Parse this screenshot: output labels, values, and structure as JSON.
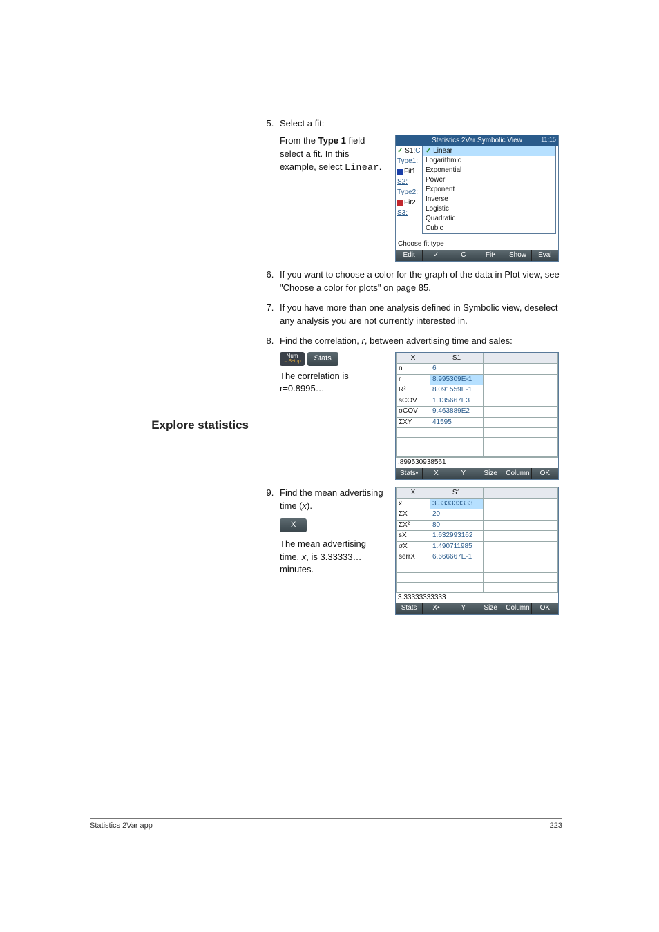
{
  "steps": {
    "s5_lead": "Select a fit:",
    "s5_body_1": "From the ",
    "s5_body_bold": "Type 1",
    "s5_body_2": " field select a fit. In this example, select ",
    "s5_body_mono": "Linear",
    "s5_body_3": ".",
    "s6": "If you want to choose a color for the graph of the data in Plot view, see \"Choose a color for plots\" on page 85.",
    "s7": "If you have more than one analysis defined in Symbolic view, deselect any analysis you are not currently interested in.",
    "s8_lead_1": "Find the correlation, ",
    "s8_lead_r": "r",
    "s8_lead_2": ", between advertising time and sales:",
    "s8_res_1": "The correlation is r=0.8995…",
    "s9_lead_1": "Find the mean advertising time (",
    "s9_lead_2": ").",
    "s9_res_1": "The mean advertising time, ",
    "s9_res_2": ", is 3.33333… minutes."
  },
  "side_heading": "Explore statistics",
  "keys": {
    "num_top": "Num",
    "num_bottom": "Setup",
    "stats": "Stats",
    "x": "X"
  },
  "calc1": {
    "title": "Statistics 2Var Symbolic View",
    "time": "11:15",
    "left_labels": [
      "✓ S1:",
      "Type1:",
      "Fit1",
      "S2:",
      "Type2:",
      "Fit2",
      "S3:"
    ],
    "dropdown": [
      "Linear",
      "Logarithmic",
      "Exponential",
      "Power",
      "Exponent",
      "Inverse",
      "Logistic",
      "Quadratic",
      "Cubic"
    ],
    "hint": "Choose fit type",
    "menu": [
      "Edit",
      "✓",
      "C",
      "Fit•",
      "Show",
      "Eval"
    ]
  },
  "stats1": {
    "headers": [
      "X",
      "S1",
      "",
      "",
      ""
    ],
    "rows": [
      [
        "n",
        "6"
      ],
      [
        "r",
        "8.995309E-1"
      ],
      [
        "R²",
        "8.091559E-1"
      ],
      [
        "sCOV",
        "1.135667E3"
      ],
      [
        "σCOV",
        "9.463889E2"
      ],
      [
        "ΣXY",
        "41595"
      ]
    ],
    "echo": ".899530938561",
    "menu": [
      "Stats•",
      "X",
      "Y",
      "Size",
      "Column",
      "OK"
    ]
  },
  "stats2": {
    "headers": [
      "X",
      "S1",
      "",
      "",
      ""
    ],
    "rows": [
      [
        "x̄",
        "3.333333333"
      ],
      [
        "ΣX",
        "20"
      ],
      [
        "ΣX²",
        "80"
      ],
      [
        "sX",
        "1.632993162"
      ],
      [
        "σX",
        "1.490711985"
      ],
      [
        "serrX",
        "6.666667E-1"
      ]
    ],
    "echo": "3.33333333333",
    "menu": [
      "Stats",
      "X•",
      "Y",
      "Size",
      "Column",
      "OK"
    ]
  },
  "footer": {
    "left": "Statistics 2Var app",
    "right": "223"
  }
}
